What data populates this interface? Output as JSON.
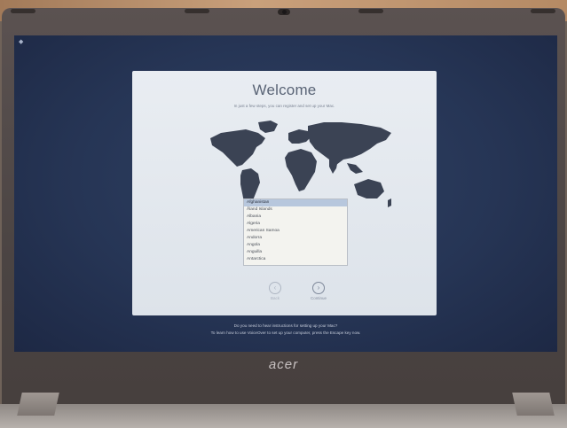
{
  "screen": {
    "title": "Welcome",
    "subtitle": "In just a few steps, you can register and set up your Mac.",
    "countries": [
      "Afghanistan",
      "Åland Islands",
      "Albania",
      "Algeria",
      "American Samoa",
      "Andorra",
      "Angola",
      "Anguilla",
      "Antarctica"
    ],
    "selected_country": "Afghanistan",
    "back_label": "Back",
    "continue_label": "Continue",
    "footer_line1": "Do you need to hear instructions for setting up your Mac?",
    "footer_line2": "To learn how to use VoiceOver to set up your computer, press the Escape key now."
  },
  "laptop": {
    "brand": "acer"
  }
}
